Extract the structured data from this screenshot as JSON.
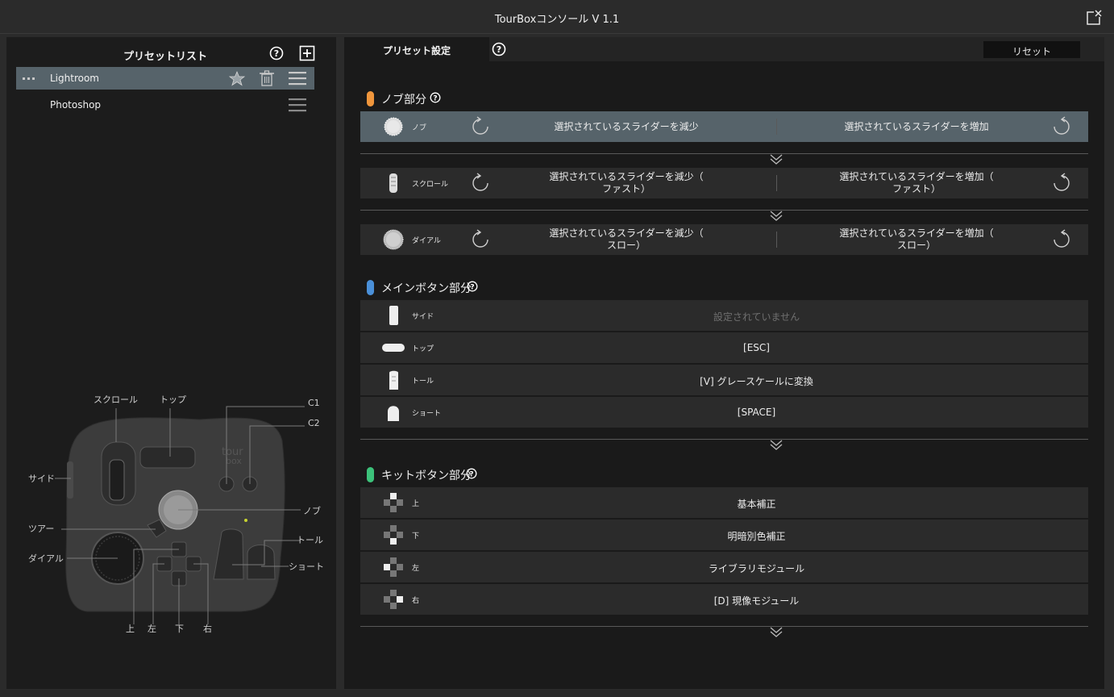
{
  "window": {
    "title": "TourBoxコンソール V 1.1"
  },
  "preset_list": {
    "title": "プリセットリスト",
    "items": [
      {
        "name": "Lightroom",
        "active": true
      },
      {
        "name": "Photoshop",
        "active": false
      }
    ]
  },
  "device": {
    "labels": {
      "scroll": "スクロール",
      "top": "トップ",
      "c1": "C1",
      "c2": "C2",
      "side": "サイド",
      "knob": "ノブ",
      "tour": "ツアー",
      "tall": "トール",
      "dial": "ダイアル",
      "short": "ショート",
      "up": "上",
      "left": "左",
      "down": "下",
      "right": "右"
    }
  },
  "preset_settings": {
    "tab_label": "プリセット設定",
    "reset_label": "リセット",
    "knob_section": {
      "title": "ノブ部分",
      "color": "#f0963c",
      "rows": [
        {
          "label": "ノブ",
          "left": "選択されているスライダーを減少",
          "right": "選択されているスライダーを増加"
        },
        {
          "label": "スクロール",
          "left": "選択されているスライダーを減少（ ファスト）",
          "right": "選択されているスライダーを増加（ ファスト）"
        },
        {
          "label": "ダイアル",
          "left": "選択されているスライダーを減少（ スロー）",
          "right": "選択されているスライダーを増加（ スロー）"
        }
      ]
    },
    "main_section": {
      "title": "メインボタン部分",
      "color": "#4a90d9",
      "rows": [
        {
          "label": "サイド",
          "action": "設定されていません"
        },
        {
          "label": "トップ",
          "action": "[ESC]"
        },
        {
          "label": "トール",
          "action": "[V] グレースケールに変換"
        },
        {
          "label": "ショート",
          "action": "[SPACE]"
        }
      ]
    },
    "kit_section": {
      "title": "キットボタン部分",
      "color": "#3cc27a",
      "rows": [
        {
          "label": "上",
          "action": "基本補正"
        },
        {
          "label": "下",
          "action": "明暗別色補正"
        },
        {
          "label": "左",
          "action": "ライブラリモジュール"
        },
        {
          "label": "右",
          "action": "[D] 現像モジュール"
        }
      ]
    }
  }
}
